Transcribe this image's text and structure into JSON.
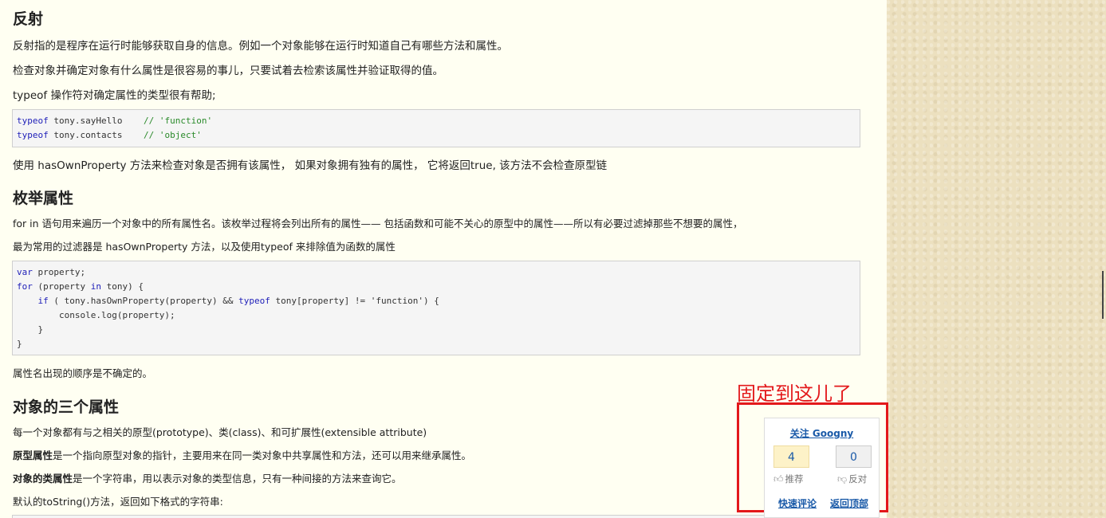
{
  "reflection": {
    "heading": "反射",
    "p1": "反射指的是程序在运行时能够获取自身的信息。例如一个对象能够在运行时知道自己有哪些方法和属性。",
    "p2": "检查对象并确定对象有什么属性是很容易的事儿，只要试着去检索该属性并验证取得的值。",
    "p3": "typeof 操作符对确定属性的类型很有帮助;",
    "code": [
      {
        "kw": "typeof",
        "rest": " tony.sayHello    ",
        "comment": "// 'function'"
      },
      {
        "kw": "typeof",
        "rest": " tony.contacts    ",
        "comment": "// 'object'"
      }
    ],
    "p4": "使用 hasOwnProperty 方法来检查对象是否拥有该属性， 如果对象拥有独有的属性， 它将返回true, 该方法不会检查原型链"
  },
  "enumeration": {
    "heading": "枚举属性",
    "p1": "for in 语句用来遍历一个对象中的所有属性名。该枚举过程将会列出所有的属性—— 包括函数和可能不关心的原型中的属性——所以有必要过滤掉那些不想要的属性，",
    "p2": "最为常用的过滤器是 hasOwnProperty 方法，以及使用typeof 来排除值为函数的属性",
    "code": {
      "l1_kw": "var",
      "l1_rest": " property;",
      "l2_kw": "for",
      "l2_a": " (property ",
      "l2_kw2": "in",
      "l2_b": " tony) {",
      "l3_indent": "    ",
      "l3_kw": "if",
      "l3_a": " ( tony.hasOwnProperty(property) && ",
      "l3_kw2": "typeof",
      "l3_b": " tony[property] != 'function') {",
      "l4": "        console.log(property);",
      "l5": "    }",
      "l6": "}"
    },
    "p3": "属性名出现的顺序是不确定的。"
  },
  "three_props": {
    "heading": "对象的三个属性",
    "p1": "每一个对象都有与之相关的原型(prototype)、类(class)、和可扩展性(extensible attribute)",
    "p2_bold": "原型属性",
    "p2_rest": "是一个指向原型对象的指针，主要用来在同一类对象中共享属性和方法，还可以用来继承属性。",
    "p3_bold": "对象的类属性",
    "p3_rest": "是一个字符串，用以表示对象的类型信息，只有一种间接的方法来查询它。",
    "p4": "默认的toString()方法，返回如下格式的字符串:"
  },
  "annotation": "固定到这儿了",
  "widget": {
    "follow": "关注 Googny",
    "up_count": "4",
    "down_count": "0",
    "up_label": "推荐",
    "down_label": "反对",
    "quick_comment": "快速评论",
    "back_top": "返回顶部"
  },
  "colors": {
    "annotation": "#e3181b",
    "link": "#1a5aa8",
    "keyword": "#1e1eb8",
    "comment": "#2a8a2a"
  }
}
